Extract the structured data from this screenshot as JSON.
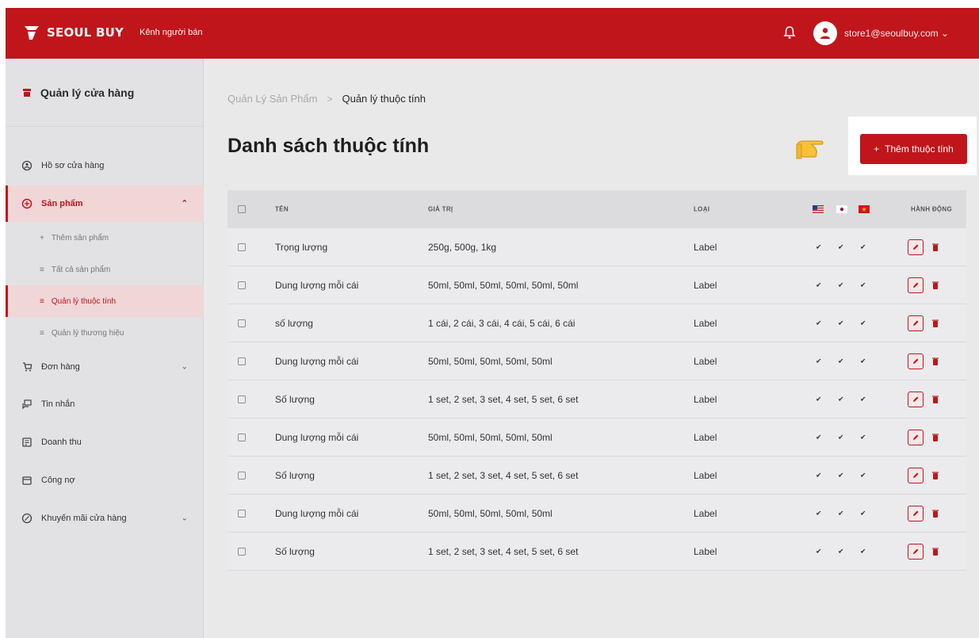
{
  "header": {
    "brand": "SEOUL BUY",
    "channel": "Kênh người bán",
    "user_email": "store1@seoulbuy.com"
  },
  "sidebar": {
    "store_title": "Quản lý cửa hàng",
    "items": [
      {
        "label": "Hồ sơ cửa hàng",
        "icon": "store-profile-icon"
      },
      {
        "label": "Sản phẩm",
        "icon": "product-icon",
        "expanded": true
      },
      {
        "label": "Đơn hàng",
        "icon": "order-icon"
      },
      {
        "label": "Tin nhắn",
        "icon": "message-icon"
      },
      {
        "label": "Doanh thu",
        "icon": "revenue-icon"
      },
      {
        "label": "Công nợ",
        "icon": "debt-icon"
      },
      {
        "label": "Khuyến mãi cửa hàng",
        "icon": "promotion-icon"
      }
    ],
    "subitems": [
      {
        "label": "Thêm sản phẩm",
        "icon": "plus-icon"
      },
      {
        "label": "Tất cả sản phẩm",
        "icon": "list-icon"
      },
      {
        "label": "Quản lý thuộc tính",
        "icon": "list-icon",
        "active": true
      },
      {
        "label": "Quản lý thương hiệu",
        "icon": "list-icon"
      }
    ]
  },
  "breadcrumb": {
    "parent": "Quản Lý Sản Phẩm",
    "separator": ">",
    "current": "Quản lý thuộc tính"
  },
  "page_title": "Danh sách thuộc tính",
  "add_button": "Thêm thuộc tính",
  "table": {
    "columns": {
      "name": "TÊN",
      "value": "GIÁ TRỊ",
      "type": "LOẠI",
      "action": "HÀNH ĐỘNG"
    },
    "flags": [
      "us-flag-icon",
      "kr-flag-icon",
      "vn-flag-icon"
    ],
    "rows": [
      {
        "name": "Trọng lượng",
        "value": "250g, 500g, 1kg",
        "type": "Label"
      },
      {
        "name": "Dung lượng mỗi cái",
        "value": "50ml, 50ml, 50ml, 50ml, 50ml, 50ml",
        "type": "Label"
      },
      {
        "name": "số lượng",
        "value": "1 cái, 2 cái, 3 cái, 4 cái, 5 cái, 6 cái",
        "type": "Label"
      },
      {
        "name": "Dung lượng mỗi cái",
        "value": "50ml, 50ml, 50ml, 50ml, 50ml",
        "type": "Label"
      },
      {
        "name": "Số lượng",
        "value": "1 set, 2 set, 3 set, 4 set, 5 set, 6 set",
        "type": "Label"
      },
      {
        "name": "Dung lượng mỗi cái",
        "value": "50ml, 50ml, 50ml, 50ml, 50ml",
        "type": "Label"
      },
      {
        "name": "Số lượng",
        "value": "1 set, 2 set, 3 set, 4 set, 5 set, 6 set",
        "type": "Label"
      },
      {
        "name": "Dung lượng mỗi cái",
        "value": "50ml, 50ml, 50ml, 50ml, 50ml",
        "type": "Label"
      },
      {
        "name": "Số lượng",
        "value": "1 set, 2 set, 3 set, 4 set, 5 set, 6 set",
        "type": "Label"
      }
    ]
  },
  "colors": {
    "brand_red": "#c0151b",
    "background": "#e9e9ea",
    "sidebar_active_bg": "#f0d6d7"
  }
}
